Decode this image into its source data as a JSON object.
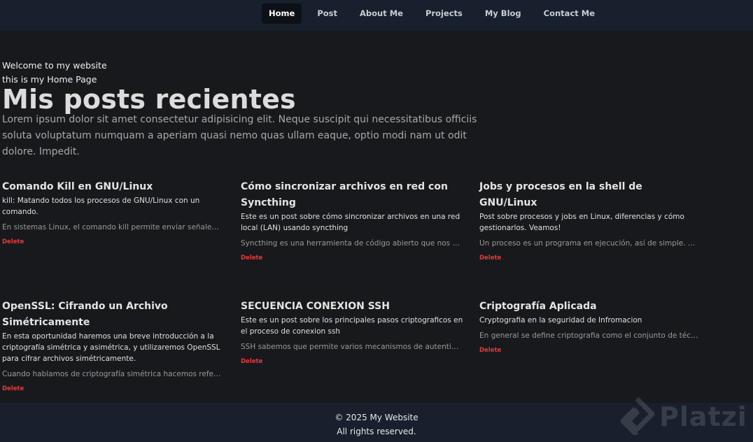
{
  "nav": {
    "items": [
      {
        "label": "Home",
        "active": true
      },
      {
        "label": "Post",
        "active": false
      },
      {
        "label": "About Me",
        "active": false
      },
      {
        "label": "Projects",
        "active": false
      },
      {
        "label": "My Blog",
        "active": false
      },
      {
        "label": "Contact Me",
        "active": false
      }
    ]
  },
  "intro": {
    "welcome": "Welcome to my website",
    "subtitle": "this is my Home Page"
  },
  "main": {
    "title": "Mis posts recientes",
    "lead": "Lorem ipsum dolor sit amet consectetur adipisicing elit. Neque suscipit qui necessitatibus officiis soluta voluptatum numquam a aperiam quasi nemo quas ullam eaque, optio modi nam ut odit dolore. Impedit."
  },
  "posts": [
    {
      "title": "Comando Kill en GNU/Linux",
      "description": "kill: Matando todos los procesos de GNU/Linux con un comando.",
      "excerpt": "En sistemas Linux, el comando kill permite enviar señales a l…",
      "delete_label": "Delete"
    },
    {
      "title": "Cómo sincronizar archivos en red con Syncthing",
      "description": "Este es un post sobre cómo sincronizar archivos en una red local (LAN) usando syncthing",
      "excerpt": "Syncthing es una herramienta de código abierto que nos per…",
      "delete_label": "Delete"
    },
    {
      "title": "Jobs y procesos en la shell de GNU/Linux",
      "description": "Post sobre procesos y jobs en Linux, diferencias y cómo gestionarlos. Veamos!",
      "excerpt": "Un proceso es un programa en ejecución, así de simple. Cua…",
      "delete_label": "Delete"
    },
    {
      "title": "OpenSSL: Cifrando un Archivo Simétricamente",
      "description": "En esta oportunidad haremos una breve introducción a la criptografía simétrica y asimétrica, y utilizaremos OpenSSL para cifrar archivos simétricamente.",
      "excerpt": "Cuando hablamos de criptografía simétrica hacemos refere…",
      "delete_label": "Delete"
    },
    {
      "title": "SECUENCIA CONEXION SSH",
      "description": "Este es un post sobre los principales pasos criptograficos en el proceso de conexion ssh",
      "excerpt": "SSH sabemos que permite varios mecanismos de autenticaci…",
      "delete_label": "Delete"
    },
    {
      "title": "Criptografía Aplicada",
      "description": "Cryptografia en la seguridad de Infromacion",
      "excerpt": "En general se define criptografia como el conjunto de técnic…",
      "delete_label": "Delete"
    }
  ],
  "footer": {
    "copyright": "© 2025 My Website",
    "rights": "All rights reserved."
  },
  "watermark": {
    "text": "Platzi",
    "icon": "platzi-logo-icon"
  },
  "colors": {
    "nav_bg": "#17202c",
    "page_bg": "#18191c",
    "delete": "#e43b3b",
    "active_nav": "#0d1117"
  }
}
